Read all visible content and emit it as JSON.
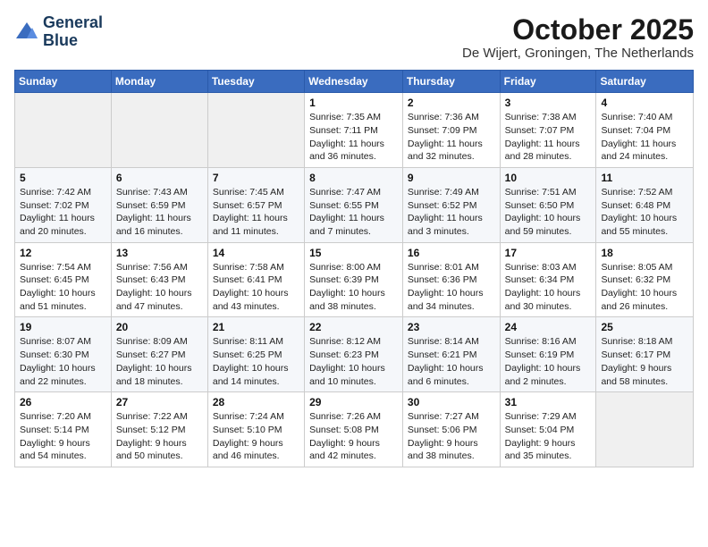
{
  "header": {
    "logo_line1": "General",
    "logo_line2": "Blue",
    "title": "October 2025",
    "subtitle": "De Wijert, Groningen, The Netherlands"
  },
  "weekdays": [
    "Sunday",
    "Monday",
    "Tuesday",
    "Wednesday",
    "Thursday",
    "Friday",
    "Saturday"
  ],
  "weeks": [
    [
      {
        "day": "",
        "info": ""
      },
      {
        "day": "",
        "info": ""
      },
      {
        "day": "",
        "info": ""
      },
      {
        "day": "1",
        "info": "Sunrise: 7:35 AM\nSunset: 7:11 PM\nDaylight: 11 hours\nand 36 minutes."
      },
      {
        "day": "2",
        "info": "Sunrise: 7:36 AM\nSunset: 7:09 PM\nDaylight: 11 hours\nand 32 minutes."
      },
      {
        "day": "3",
        "info": "Sunrise: 7:38 AM\nSunset: 7:07 PM\nDaylight: 11 hours\nand 28 minutes."
      },
      {
        "day": "4",
        "info": "Sunrise: 7:40 AM\nSunset: 7:04 PM\nDaylight: 11 hours\nand 24 minutes."
      }
    ],
    [
      {
        "day": "5",
        "info": "Sunrise: 7:42 AM\nSunset: 7:02 PM\nDaylight: 11 hours\nand 20 minutes."
      },
      {
        "day": "6",
        "info": "Sunrise: 7:43 AM\nSunset: 6:59 PM\nDaylight: 11 hours\nand 16 minutes."
      },
      {
        "day": "7",
        "info": "Sunrise: 7:45 AM\nSunset: 6:57 PM\nDaylight: 11 hours\nand 11 minutes."
      },
      {
        "day": "8",
        "info": "Sunrise: 7:47 AM\nSunset: 6:55 PM\nDaylight: 11 hours\nand 7 minutes."
      },
      {
        "day": "9",
        "info": "Sunrise: 7:49 AM\nSunset: 6:52 PM\nDaylight: 11 hours\nand 3 minutes."
      },
      {
        "day": "10",
        "info": "Sunrise: 7:51 AM\nSunset: 6:50 PM\nDaylight: 10 hours\nand 59 minutes."
      },
      {
        "day": "11",
        "info": "Sunrise: 7:52 AM\nSunset: 6:48 PM\nDaylight: 10 hours\nand 55 minutes."
      }
    ],
    [
      {
        "day": "12",
        "info": "Sunrise: 7:54 AM\nSunset: 6:45 PM\nDaylight: 10 hours\nand 51 minutes."
      },
      {
        "day": "13",
        "info": "Sunrise: 7:56 AM\nSunset: 6:43 PM\nDaylight: 10 hours\nand 47 minutes."
      },
      {
        "day": "14",
        "info": "Sunrise: 7:58 AM\nSunset: 6:41 PM\nDaylight: 10 hours\nand 43 minutes."
      },
      {
        "day": "15",
        "info": "Sunrise: 8:00 AM\nSunset: 6:39 PM\nDaylight: 10 hours\nand 38 minutes."
      },
      {
        "day": "16",
        "info": "Sunrise: 8:01 AM\nSunset: 6:36 PM\nDaylight: 10 hours\nand 34 minutes."
      },
      {
        "day": "17",
        "info": "Sunrise: 8:03 AM\nSunset: 6:34 PM\nDaylight: 10 hours\nand 30 minutes."
      },
      {
        "day": "18",
        "info": "Sunrise: 8:05 AM\nSunset: 6:32 PM\nDaylight: 10 hours\nand 26 minutes."
      }
    ],
    [
      {
        "day": "19",
        "info": "Sunrise: 8:07 AM\nSunset: 6:30 PM\nDaylight: 10 hours\nand 22 minutes."
      },
      {
        "day": "20",
        "info": "Sunrise: 8:09 AM\nSunset: 6:27 PM\nDaylight: 10 hours\nand 18 minutes."
      },
      {
        "day": "21",
        "info": "Sunrise: 8:11 AM\nSunset: 6:25 PM\nDaylight: 10 hours\nand 14 minutes."
      },
      {
        "day": "22",
        "info": "Sunrise: 8:12 AM\nSunset: 6:23 PM\nDaylight: 10 hours\nand 10 minutes."
      },
      {
        "day": "23",
        "info": "Sunrise: 8:14 AM\nSunset: 6:21 PM\nDaylight: 10 hours\nand 6 minutes."
      },
      {
        "day": "24",
        "info": "Sunrise: 8:16 AM\nSunset: 6:19 PM\nDaylight: 10 hours\nand 2 minutes."
      },
      {
        "day": "25",
        "info": "Sunrise: 8:18 AM\nSunset: 6:17 PM\nDaylight: 9 hours\nand 58 minutes."
      }
    ],
    [
      {
        "day": "26",
        "info": "Sunrise: 7:20 AM\nSunset: 5:14 PM\nDaylight: 9 hours\nand 54 minutes."
      },
      {
        "day": "27",
        "info": "Sunrise: 7:22 AM\nSunset: 5:12 PM\nDaylight: 9 hours\nand 50 minutes."
      },
      {
        "day": "28",
        "info": "Sunrise: 7:24 AM\nSunset: 5:10 PM\nDaylight: 9 hours\nand 46 minutes."
      },
      {
        "day": "29",
        "info": "Sunrise: 7:26 AM\nSunset: 5:08 PM\nDaylight: 9 hours\nand 42 minutes."
      },
      {
        "day": "30",
        "info": "Sunrise: 7:27 AM\nSunset: 5:06 PM\nDaylight: 9 hours\nand 38 minutes."
      },
      {
        "day": "31",
        "info": "Sunrise: 7:29 AM\nSunset: 5:04 PM\nDaylight: 9 hours\nand 35 minutes."
      },
      {
        "day": "",
        "info": ""
      }
    ]
  ]
}
